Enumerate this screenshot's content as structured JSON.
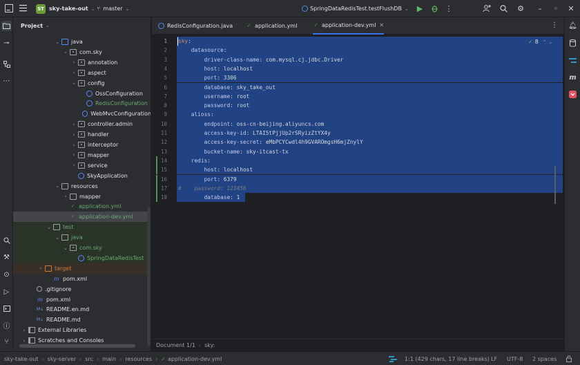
{
  "titlebar": {
    "project_badge": "ST",
    "project_name": "sky-take-out",
    "branch": "master",
    "run_config": "SpringDataRedisTest.testFlushDB"
  },
  "project_panel": {
    "title": "Project",
    "items": [
      {
        "label": "java",
        "indent": 4,
        "arrow": "down",
        "icon": "folder blue"
      },
      {
        "label": "com.sky",
        "indent": 5,
        "arrow": "down",
        "icon": "pkg"
      },
      {
        "label": "annotation",
        "indent": 6,
        "arrow": "right",
        "icon": "pkg"
      },
      {
        "label": "aspect",
        "indent": 6,
        "arrow": "right",
        "icon": "pkg"
      },
      {
        "label": "config",
        "indent": 6,
        "arrow": "down",
        "icon": "pkg"
      },
      {
        "label": "OssConfiguration",
        "indent": 7,
        "arrow": "",
        "icon": "cls"
      },
      {
        "label": "RedisConfiguration",
        "indent": 7,
        "arrow": "",
        "icon": "cls",
        "color": "green"
      },
      {
        "label": "WebMvcConfiguration",
        "indent": 7,
        "arrow": "",
        "icon": "cls"
      },
      {
        "label": "controller.admin",
        "indent": 6,
        "arrow": "right",
        "icon": "pkg"
      },
      {
        "label": "handler",
        "indent": 6,
        "arrow": "right",
        "icon": "pkg"
      },
      {
        "label": "interceptor",
        "indent": 6,
        "arrow": "right",
        "icon": "pkg"
      },
      {
        "label": "mapper",
        "indent": 6,
        "arrow": "right",
        "icon": "pkg"
      },
      {
        "label": "service",
        "indent": 6,
        "arrow": "right",
        "icon": "pkg"
      },
      {
        "label": "SkyApplication",
        "indent": 6,
        "arrow": "",
        "icon": "cls"
      },
      {
        "label": "resources",
        "indent": 4,
        "arrow": "down",
        "icon": "folder"
      },
      {
        "label": "mapper",
        "indent": 5,
        "arrow": "right",
        "icon": "folder"
      },
      {
        "label": "application.yml",
        "indent": 5,
        "arrow": "",
        "icon": "yml",
        "color": "green"
      },
      {
        "label": "application-dev.yml",
        "indent": 5,
        "arrow": "",
        "icon": "yml",
        "color": "green",
        "selected": true
      },
      {
        "label": "test",
        "indent": 3,
        "arrow": "down",
        "icon": "folder",
        "color": "green",
        "bg": "test"
      },
      {
        "label": "java",
        "indent": 4,
        "arrow": "down",
        "icon": "folder",
        "color": "green",
        "bg": "test"
      },
      {
        "label": "com.sky",
        "indent": 5,
        "arrow": "down",
        "icon": "pkg",
        "color": "green",
        "bg": "test"
      },
      {
        "label": "SpringDataRedisTest",
        "indent": 6,
        "arrow": "",
        "icon": "cls",
        "color": "green",
        "bg": "test"
      },
      {
        "label": "target",
        "indent": 2,
        "arrow": "right",
        "icon": "folder orange",
        "color": "orange",
        "bg": "target"
      },
      {
        "label": "pom.xml",
        "indent": 3,
        "arrow": "",
        "icon": "mfile"
      },
      {
        "label": ".gitignore",
        "indent": 1,
        "arrow": "",
        "icon": "git"
      },
      {
        "label": "pom.xml",
        "indent": 1,
        "arrow": "",
        "icon": "mfile"
      },
      {
        "label": "README.en.md",
        "indent": 1,
        "arrow": "",
        "icon": "md"
      },
      {
        "label": "README.md",
        "indent": 1,
        "arrow": "",
        "icon": "md"
      },
      {
        "label": "External Libraries",
        "indent": 0,
        "arrow": "right",
        "icon": "lib"
      },
      {
        "label": "Scratches and Consoles",
        "indent": 0,
        "arrow": "right",
        "icon": "lib"
      }
    ]
  },
  "tabs": [
    {
      "label": "RedisConfiguration.java",
      "icon": "cls",
      "active": false
    },
    {
      "label": "application.yml",
      "icon": "yml",
      "active": false
    },
    {
      "label": "application-dev.yml",
      "icon": "yml",
      "active": true
    }
  ],
  "inspection": {
    "count": "8"
  },
  "editor": {
    "lines": [
      {
        "n": "1",
        "indent": 0,
        "key": "sky",
        "value": ""
      },
      {
        "n": "2",
        "indent": 1,
        "key": "datasource",
        "value": ""
      },
      {
        "n": "3",
        "indent": 2,
        "key": "driver-class-name",
        "value": "com.mysql.cj.jdbc.Driver"
      },
      {
        "n": "4",
        "indent": 2,
        "key": "host",
        "value": "localhost"
      },
      {
        "n": "5",
        "indent": 2,
        "key": "port",
        "value": "3306"
      },
      {
        "n": "6",
        "indent": 2,
        "key": "database",
        "value": "sky_take_out"
      },
      {
        "n": "7",
        "indent": 2,
        "key": "username",
        "value": "root"
      },
      {
        "n": "8",
        "indent": 2,
        "key": "password",
        "value": "root"
      },
      {
        "n": "9",
        "indent": 1,
        "key": "alioss",
        "value": ""
      },
      {
        "n": "10",
        "indent": 2,
        "key": "endpoint",
        "value": "oss-cn-beijing.aliyuncs.com"
      },
      {
        "n": "11",
        "indent": 2,
        "key": "access-key-id",
        "value": "LTAI5tPjjUp2rSRyizZtYX4y"
      },
      {
        "n": "12",
        "indent": 2,
        "key": "access-key-secret",
        "value": "eMbPCYCwdl4h9GVAROmgsH6mjZnylY"
      },
      {
        "n": "13",
        "indent": 2,
        "key": "bucket-name",
        "value": "sky-itcast-tx"
      },
      {
        "n": "14",
        "indent": 1,
        "key": "redis",
        "value": ""
      },
      {
        "n": "15",
        "indent": 2,
        "key": "host",
        "value": "localhost"
      },
      {
        "n": "16",
        "indent": 2,
        "key": "port",
        "value": "6379"
      },
      {
        "n": "17",
        "indent": 2,
        "key": "",
        "value": "",
        "comment": "#    password: 123456"
      },
      {
        "n": "18",
        "indent": 2,
        "key": "database",
        "value": "1"
      }
    ]
  },
  "breadcrumb_bar": {
    "document": "Document 1/1",
    "path": "sky:"
  },
  "statusbar": {
    "crumbs": [
      "sky-take-out",
      "sky-server",
      "src",
      "main",
      "resources",
      "application-dev.yml"
    ],
    "position": "1:1 (429 chars, 17 line breaks)",
    "line_sep": "LF",
    "encoding": "UTF-8",
    "indent": "2 spaces"
  },
  "colors": {
    "selection": "#214283",
    "accent": "#3574f0",
    "green_status": "#549159"
  }
}
